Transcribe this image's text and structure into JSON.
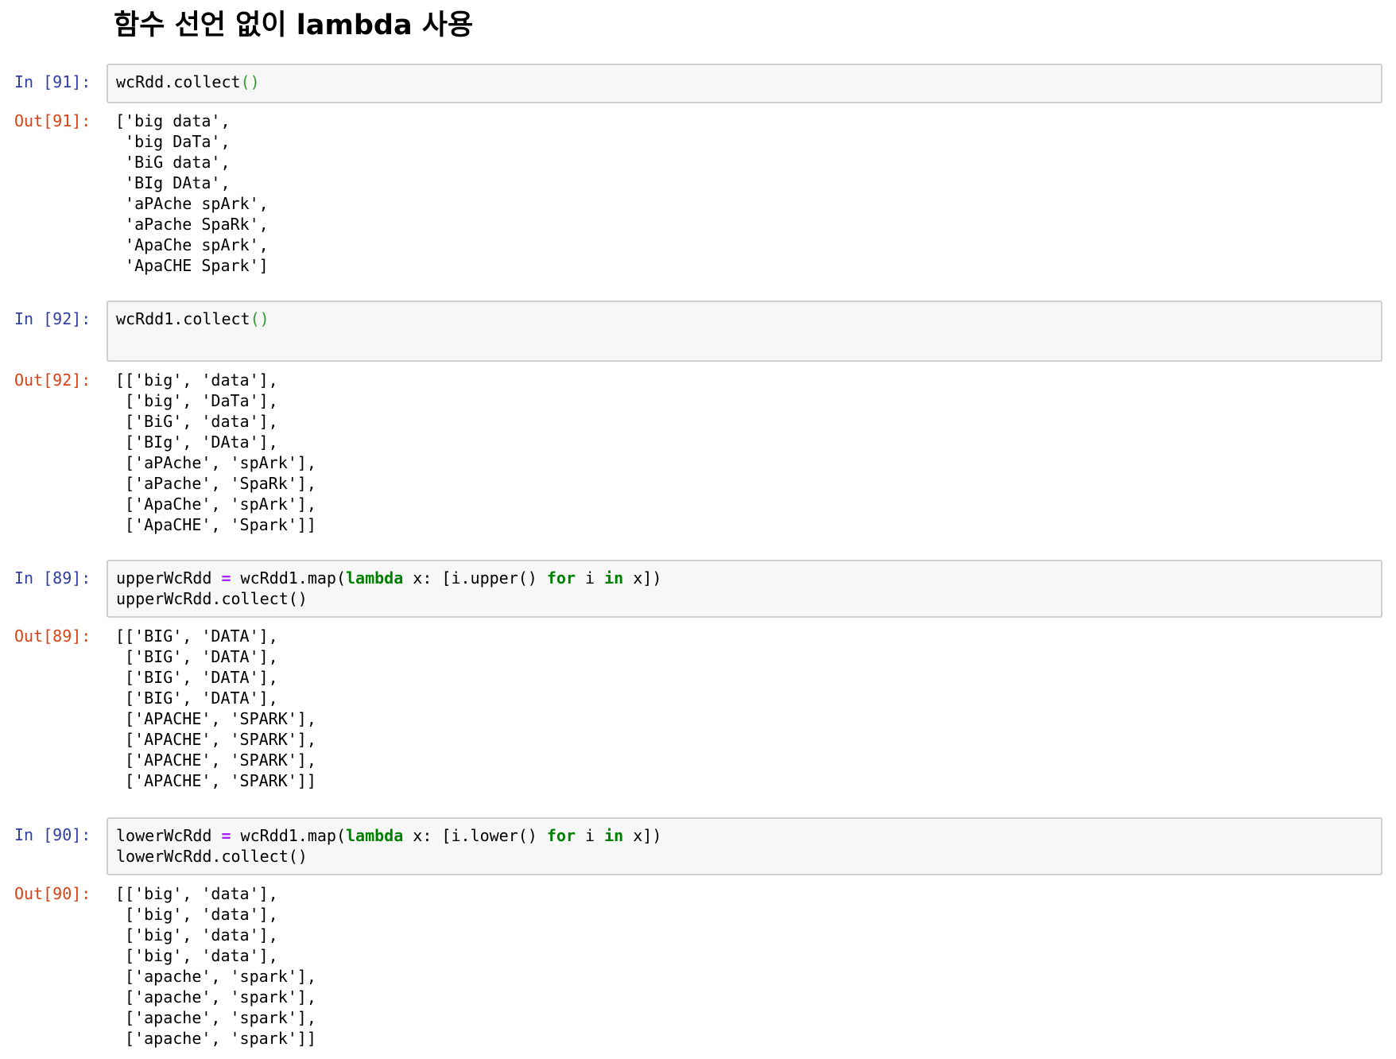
{
  "heading": "함수 선언 없이 lambda 사용",
  "cells": [
    {
      "in_prompt": "In [91]:",
      "out_prompt": "Out[91]:",
      "code": [
        {
          "a": "wcRdd.collect",
          "paren": "()"
        }
      ],
      "output": [
        "['big data',",
        " 'big DaTa',",
        " 'BiG data',",
        " 'BIg DAta',",
        " 'aPAche spArk',",
        " 'aPache SpaRk',",
        " 'ApaChe spArk',",
        " 'ApaCHE Spark']"
      ]
    },
    {
      "in_prompt": "In [92]:",
      "out_prompt": "Out[92]:",
      "code": [
        {
          "a": "wcRdd1.collect",
          "paren": "()"
        }
      ],
      "output": [
        "[['big', 'data'],",
        " ['big', 'DaTa'],",
        " ['BiG', 'data'],",
        " ['BIg', 'DAta'],",
        " ['aPAche', 'spArk'],",
        " ['aPache', 'SpaRk'],",
        " ['ApaChe', 'spArk'],",
        " ['ApaCHE', 'Spark']]"
      ]
    },
    {
      "in_prompt": "In [89]:",
      "out_prompt": "Out[89]:",
      "code": [
        {
          "var": "upperWcRdd ",
          "eq": "=",
          "call": " wcRdd1.map(",
          "kw_lambda": "lambda",
          "mid": " x: [i.upper() ",
          "kw_for": "for",
          "i": " i ",
          "kw_in": "in",
          "end": " x])"
        },
        {
          "text": "upperWcRdd.collect()"
        }
      ],
      "output": [
        "[['BIG', 'DATA'],",
        " ['BIG', 'DATA'],",
        " ['BIG', 'DATA'],",
        " ['BIG', 'DATA'],",
        " ['APACHE', 'SPARK'],",
        " ['APACHE', 'SPARK'],",
        " ['APACHE', 'SPARK'],",
        " ['APACHE', 'SPARK']]"
      ]
    },
    {
      "in_prompt": "In [90]:",
      "out_prompt": "Out[90]:",
      "code": [
        {
          "var": "lowerWcRdd ",
          "eq": "=",
          "call": " wcRdd1.map(",
          "kw_lambda": "lambda",
          "mid": " x: [i.lower() ",
          "kw_for": "for",
          "i": " i ",
          "kw_in": "in",
          "end": " x])"
        },
        {
          "text": "lowerWcRdd.collect()"
        }
      ],
      "output": [
        "[['big', 'data'],",
        " ['big', 'data'],",
        " ['big', 'data'],",
        " ['big', 'data'],",
        " ['apache', 'spark'],",
        " ['apache', 'spark'],",
        " ['apache', 'spark'],",
        " ['apache', 'spark']]"
      ]
    }
  ]
}
